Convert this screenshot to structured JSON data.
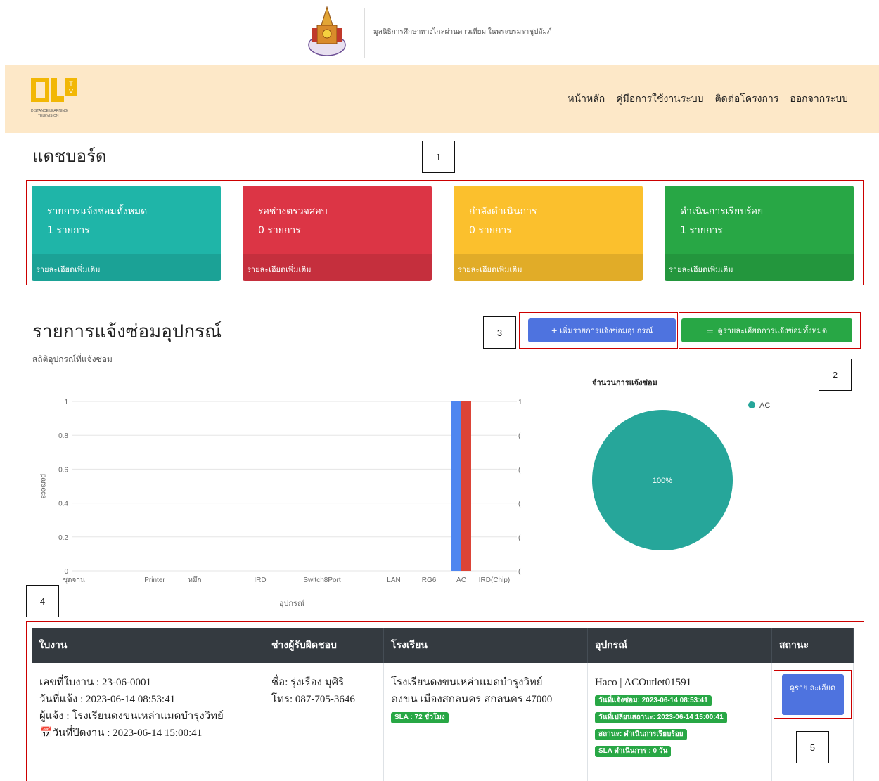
{
  "foundation": {
    "text": "มูลนิธิการศึกษาทางไกลผ่านดาวเทียม ในพระบรมราชูปถัมภ์"
  },
  "logo": {
    "letters": "DLTV",
    "caption": "DISTANCE LEARNING TELEVISION"
  },
  "nav": {
    "items": [
      "หน้าหลัก",
      "คู่มือการใช้งานระบบ",
      "ติดต่อโครงการ",
      "ออกจากระบบ"
    ]
  },
  "dashboard": {
    "title": "แดชบอร์ด"
  },
  "callouts": [
    "1",
    "2",
    "3",
    "4",
    "5"
  ],
  "cards": [
    {
      "title": "รายการแจ้งซ่อมทั้งหมด",
      "count": "1 รายการ",
      "footer": "รายละเอียดเพิ่มเติม",
      "color": "#1fb5a8"
    },
    {
      "title": "รอช่างตรวจสอบ",
      "count": "0 รายการ",
      "footer": "รายละเอียดเพิ่มเติม",
      "color": "#dc3545"
    },
    {
      "title": "กำลังดำเนินการ",
      "count": "0 รายการ",
      "footer": "รายละเอียดเพิ่มเติม",
      "color": "#fbc02d"
    },
    {
      "title": "ดำเนินการเรียบร้อย",
      "count": "1 รายการ",
      "footer": "รายละเอียดเพิ่มเติม",
      "color": "#28a745"
    }
  ],
  "section": {
    "title": "รายการแจ้งซ่อมอุปกรณ์",
    "subtitle": "สถิติอุปกรณ์ที่แจ้งซ่อม"
  },
  "buttons": {
    "add": "+ เพิ่มรายการแจ้งซ่อมอุปกรณ์",
    "all": "ดูรายละเอียดการแจ้งซ่อมทั้งหมด"
  },
  "chart_data": [
    {
      "type": "bar",
      "categories": [
        "ชุดจาน",
        "Printer",
        "หมึก",
        "IRD",
        "Switch8Port",
        "LAN",
        "RG6",
        "AC",
        "IRD(Chip)"
      ],
      "series": [
        {
          "values": [
            0,
            0,
            0,
            0,
            0,
            0,
            0,
            1,
            0
          ],
          "color": "#4e86f0"
        },
        {
          "values": [
            0,
            0,
            0,
            0,
            0,
            0,
            0,
            1,
            0
          ],
          "color": "#dc4437"
        }
      ],
      "ylabel": "parsecs",
      "xlabel": "อุปกรณ์",
      "yticks": [
        "1",
        "0.8",
        "0.6",
        "0.4",
        "0.2",
        "0"
      ],
      "right_ticks": [
        "1",
        "(",
        "(",
        "(",
        "(",
        "("
      ],
      "ylim": [
        0,
        1
      ],
      "grid": true
    },
    {
      "type": "pie",
      "title": "จำนวนการแจ้งซ่อม",
      "slices": [
        {
          "label": "AC",
          "value": 100,
          "display": "100%",
          "color": "#26a69a"
        }
      ],
      "legend": "top-right"
    }
  ],
  "table": {
    "headers": [
      "ใบงาน",
      "ช่างผู้รับผิดชอบ",
      "โรงเรียน",
      "อุปกรณ์",
      "สถานะ"
    ],
    "row": {
      "job_no": "เลขที่ใบงาน : 23-06-0001",
      "report_date": "วันที่แจ้ง : 2023-06-14 08:53:41",
      "reporter": "ผู้แจ้ง : โรงเรียนดงขนเหล่าแมดบำรุงวิทย์",
      "close_date": "วันที่ปิดงาน : 2023-06-14 15:00:41",
      "tech_name": "ชื่อ: รุ่งเรือง มุศิริ",
      "tech_phone": "โทร: 087-705-3646",
      "school_name": "โรงเรียนดงขนเหล่าแมดบำรุงวิทย์",
      "school_addr": "ดงขน เมืองสกลนคร สกลนคร 47000",
      "sla": "SLA : 72 ชั่วโมง",
      "device": "Haco | ACOutlet01591",
      "badge_report": "วันที่แจ้งซ่อม: 2023-06-14 08:53:41",
      "badge_change": "วันที่เปลี่ยนสถานะ: 2023-06-14 15:00:41",
      "badge_status": "สถานะ: ดำเนินการเรียบร้อย",
      "badge_sla": "SLA ดำเนินการ : 0 วัน",
      "detail_btn": "ดูราย ละเอียด"
    }
  }
}
